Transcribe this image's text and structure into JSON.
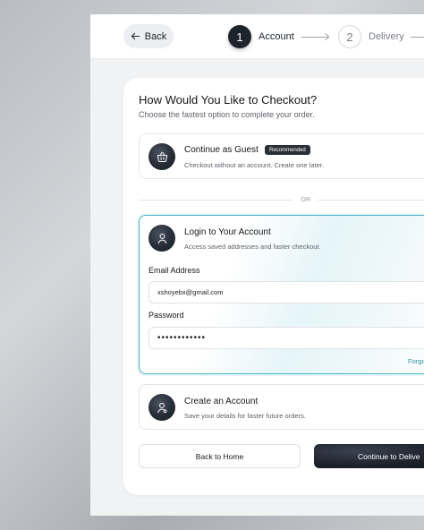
{
  "header": {
    "back_label": "Back",
    "steps": [
      {
        "number": "1",
        "label": "Account",
        "state": "active"
      },
      {
        "number": "2",
        "label": "Delivery",
        "state": "inactive"
      }
    ]
  },
  "checkout": {
    "title": "How Would You Like to Checkout?",
    "subtitle": "Choose the fastest option to complete your order.",
    "guest": {
      "title": "Continue as Guest",
      "badge": "Recommended",
      "description": "Checkout without an account. Create one later.",
      "icon": "shopping-basket-icon"
    },
    "divider_text": "OR",
    "login": {
      "title": "Login to Your Account",
      "description": "Access saved addresses and faster checkout.",
      "icon": "user-icon",
      "email_label": "Email Address",
      "email_value": "xshoyebx@gmail.com",
      "password_label": "Password",
      "password_value": "passwordtext",
      "forgot_label": "Forgo"
    },
    "create": {
      "title": "Create an Account",
      "description": "Save your details for faster future orders.",
      "icon": "user-plus-icon"
    },
    "back_home_label": "Back to Home",
    "continue_label": "Continue to Delive"
  },
  "colors": {
    "accent": "#46b6c9",
    "dark": "#1e242c"
  }
}
